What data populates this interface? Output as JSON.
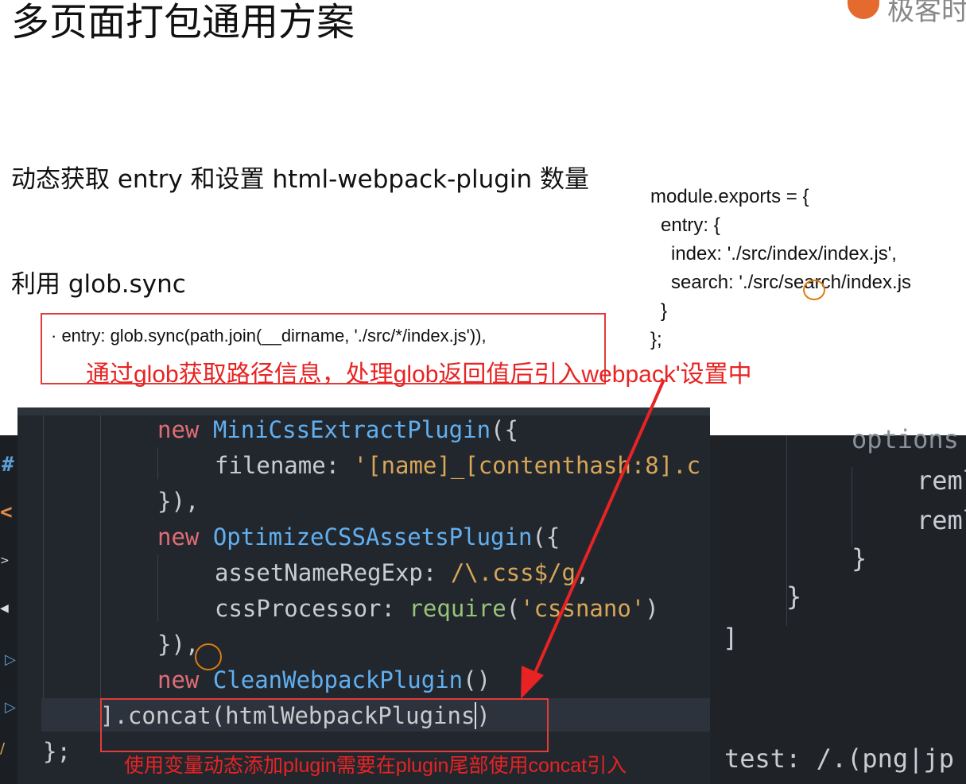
{
  "slide": {
    "title": "多页面打包通用方案",
    "logo_text": "极客时",
    "line1": "动态获取 entry 和设置 html-webpack-plugin 数量",
    "line2": "利用 glob.sync",
    "entry_code": "· entry: glob.sync(path.join(__dirname, './src/*/index.js')),",
    "entry_note": "通过glob获取路径信息，处理glob返回值后引入webpack'设置中",
    "module_exports": [
      "module.exports = {",
      "  entry: {",
      "    index: './src/index/index.js',",
      "    search: './src/search/index.js",
      "  }",
      "};"
    ]
  },
  "editor": {
    "lines": [
      [
        "new ",
        "MiniCssExtractPlugin",
        "({"
      ],
      [
        "filename: ",
        "'[name]_[contenthash:8].c"
      ],
      [
        "}),"
      ],
      [
        "new ",
        "OptimizeCSSAssetsPlugin",
        "({"
      ],
      [
        "assetNameRegExp: ",
        "/\\.css$/g",
        ","
      ],
      [
        "cssProcessor: ",
        "require",
        "(",
        "'cssnano'",
        ")"
      ],
      [
        "}),"
      ],
      [
        "new ",
        "CleanWebpackPlugin",
        "()"
      ],
      [
        "].concat(",
        "htmlWebpackPlugins",
        ")"
      ],
      [
        "};"
      ]
    ],
    "concat_note": "使用变量动态添加plugin需要在plugin尾部使用concat引入"
  },
  "right_code": {
    "options": "options",
    "rem1": "reml",
    "rem2": "reml",
    "brace1": "}",
    "brace2": "}",
    "bracket": "]",
    "test": "test: /.(png|jp"
  },
  "left_strip_glyphs": [
    "#",
    "<",
    ">",
    "◀",
    "▷",
    "▷",
    "/"
  ],
  "colors": {
    "annotation_red": "#e23b3b",
    "keyword": "#e06c75",
    "class": "#61afef",
    "string": "#d8a657",
    "function": "#98c379"
  }
}
